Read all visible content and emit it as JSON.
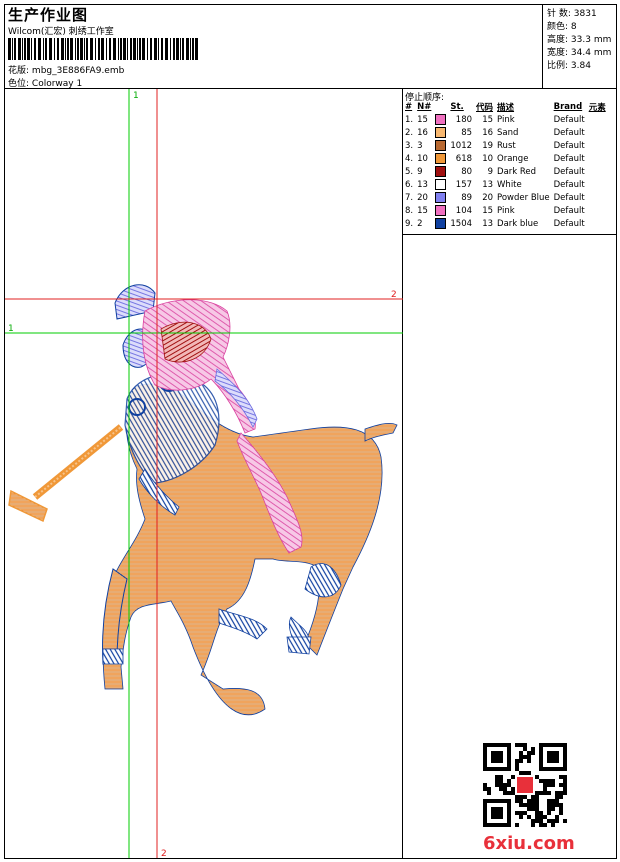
{
  "header": {
    "title": "生产作业图",
    "company": "Wilcom(汇宏) 刺绣工作室",
    "design_label": "花版:",
    "design_name": "mbg_3E886FA9.emb",
    "colorway_label": "色位:",
    "colorway_name": "Colorway 1"
  },
  "specs": [
    {
      "label": "针 数:",
      "value": "3831"
    },
    {
      "label": "颜色:",
      "value": "8"
    },
    {
      "label": "高度:",
      "value": "33.3 mm"
    },
    {
      "label": "宽度:",
      "value": "34.4 mm"
    },
    {
      "label": "比例:",
      "value": "3.84"
    }
  ],
  "guides": {
    "green_v_label": "1",
    "green_h_label": "1",
    "red_h_label": "2",
    "red_v_label": "2"
  },
  "stop_sequence": {
    "title": "停止顺序:",
    "columns": [
      "#",
      "N#",
      "St.",
      "代码",
      "描述",
      "Brand",
      "元素"
    ],
    "rows": [
      {
        "idx": "1.",
        "n": "15",
        "color": "#f070c0",
        "st": "180",
        "code": "15",
        "desc": "Pink",
        "brand": "Default"
      },
      {
        "idx": "2.",
        "n": "16",
        "color": "#f8b870",
        "st": "85",
        "code": "16",
        "desc": "Sand",
        "brand": "Default"
      },
      {
        "idx": "3.",
        "n": "3",
        "color": "#b86830",
        "st": "1012",
        "code": "19",
        "desc": "Rust",
        "brand": "Default"
      },
      {
        "idx": "4.",
        "n": "10",
        "color": "#f09838",
        "st": "618",
        "code": "10",
        "desc": "Orange",
        "brand": "Default"
      },
      {
        "idx": "5.",
        "n": "9",
        "color": "#a01010",
        "st": "80",
        "code": "9",
        "desc": "Dark Red",
        "brand": "Default"
      },
      {
        "idx": "6.",
        "n": "13",
        "color": "#ffffff",
        "st": "157",
        "code": "13",
        "desc": "White",
        "brand": "Default"
      },
      {
        "idx": "7.",
        "n": "20",
        "color": "#8080f0",
        "st": "89",
        "code": "20",
        "desc": "Powder Blue",
        "brand": "Default"
      },
      {
        "idx": "8.",
        "n": "15",
        "color": "#f070c0",
        "st": "104",
        "code": "15",
        "desc": "Pink",
        "brand": "Default"
      },
      {
        "idx": "9.",
        "n": "2",
        "color": "#1040a0",
        "st": "1504",
        "code": "13",
        "desc": "Dark blue",
        "brand": "Default"
      }
    ]
  },
  "watermark": "6xiu.com"
}
